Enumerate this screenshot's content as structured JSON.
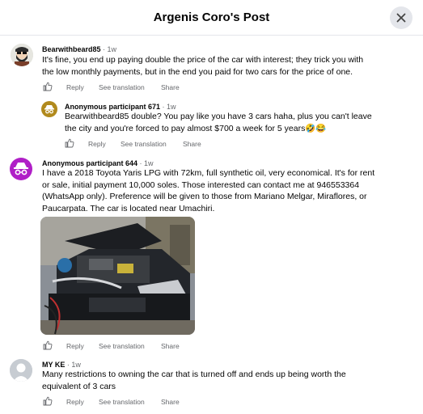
{
  "header": {
    "title": "Argenis Coro's Post"
  },
  "icons": {
    "close": "close-icon",
    "like": "thumbs-up-icon"
  },
  "comments": [
    {
      "author": "Bearwithbeard85",
      "time": "1w",
      "text_lines": [
        "It's fine, you end up paying double the price of the car with interest; they trick you with",
        "the low monthly payments, but in the end you paid for two cars for the price of one."
      ],
      "actions": {
        "reply": "Reply",
        "translate": "See translation",
        "share": "Share"
      }
    },
    {
      "author": "Anonymous participant 671",
      "time": "1w",
      "text_lines": [
        "Bearwithbeard85 double? You pay like you have 3 cars haha, plus you can't leave",
        "the city and you're forced to pay almost $700 a week for 5 years🤣😂"
      ],
      "actions": {
        "reply": "Reply",
        "translate": "See translation",
        "share": "Share"
      }
    },
    {
      "author": "Anonymous participant 644",
      "time": "1w",
      "text_lines": [
        "I have a 2018 Toyota Yaris LPG with 72km, full synthetic oil, very economical. It's for rent",
        "or sale, initial payment 10,000 soles. Those interested can contact me at 946553364",
        "(WhatsApp only). Preference will be given to those from Mariano Melgar, Miraflores, or",
        "Paucarpata. The car is located near Umachiri."
      ],
      "actions": {
        "reply": "Reply",
        "translate": "See translation",
        "share": "Share"
      }
    },
    {
      "author": "MY KE",
      "time": "1w",
      "text_lines": [
        "Many restrictions to owning the car that is turned off and ends up being worth the",
        "equivalent of 3 cars"
      ],
      "actions": {
        "reply": "Reply",
        "translate": "See translation",
        "share": "Share"
      }
    }
  ],
  "colors": {
    "secondary_text": "#65676b",
    "anon_purple": "#b01fc7",
    "anon_gold": "#b18a1d"
  }
}
